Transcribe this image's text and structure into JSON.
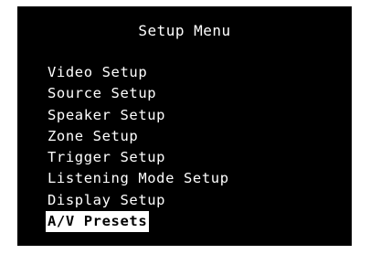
{
  "menu": {
    "title": "Setup Menu",
    "items": [
      {
        "label": "Video Setup",
        "selected": false
      },
      {
        "label": "Source Setup",
        "selected": false
      },
      {
        "label": "Speaker Setup",
        "selected": false
      },
      {
        "label": "Zone Setup",
        "selected": false
      },
      {
        "label": "Trigger Setup",
        "selected": false
      },
      {
        "label": "Listening Mode Setup",
        "selected": false
      },
      {
        "label": "Display Setup",
        "selected": false
      },
      {
        "label": "A/V Presets",
        "selected": true
      }
    ]
  },
  "colors": {
    "background": "#000000",
    "text": "#ffffff",
    "selection_background": "#ffffff",
    "selection_text": "#000000"
  }
}
